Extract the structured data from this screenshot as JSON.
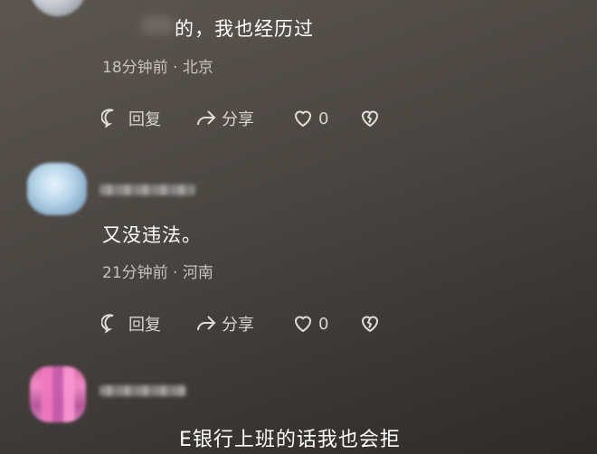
{
  "comments": [
    {
      "text": "的，我也经历过",
      "time": "18分钟前",
      "separator": "·",
      "location": "北京",
      "reply_label": "回复",
      "share_label": "分享",
      "like_count": "0"
    },
    {
      "text": "又没违法。",
      "time": "21分钟前",
      "separator": "·",
      "location": "河南",
      "reply_label": "回复",
      "share_label": "分享",
      "like_count": "0"
    },
    {
      "text": ""
    }
  ],
  "bottom_caption": "E银行上班的话我也会拒",
  "icons": {
    "reply": "comment-bubble-icon",
    "share": "share-arrow-icon",
    "like": "heart-icon",
    "dislike": "broken-heart-icon"
  }
}
